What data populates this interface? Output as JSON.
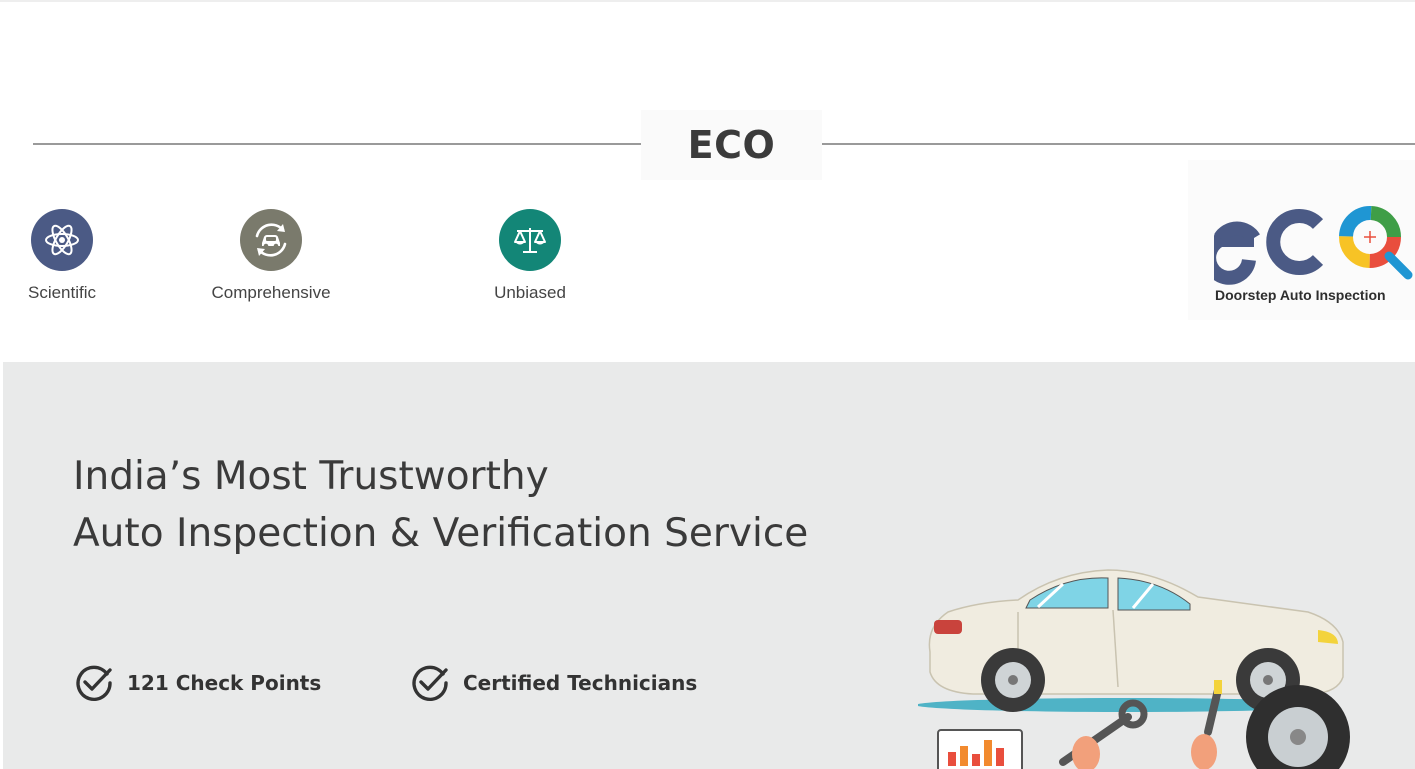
{
  "section": {
    "heading": "ECO"
  },
  "features": [
    {
      "label": "Scientific",
      "icon": "atom-icon",
      "color": "#4b5a85"
    },
    {
      "label": "Comprehensive",
      "icon": "car-cycle-icon",
      "color": "#7a7a6c"
    },
    {
      "label": "Unbiased",
      "icon": "balance-scale-icon",
      "color": "#138677"
    }
  ],
  "logo": {
    "tagline": "Doorstep Auto Inspection",
    "colors": [
      "#4b5a85",
      "#e94e3d",
      "#f7c325",
      "#3f9e47",
      "#1f96d3"
    ]
  },
  "hero": {
    "title_line1": "India’s Most Trustworthy",
    "title_line2": "Auto Inspection & Verification Service",
    "checks": [
      {
        "label": "121 Check Points",
        "icon": "check-circle-icon"
      },
      {
        "label": "Certified Technicians",
        "icon": "check-circle-icon"
      }
    ],
    "background": "#e9eaea"
  }
}
